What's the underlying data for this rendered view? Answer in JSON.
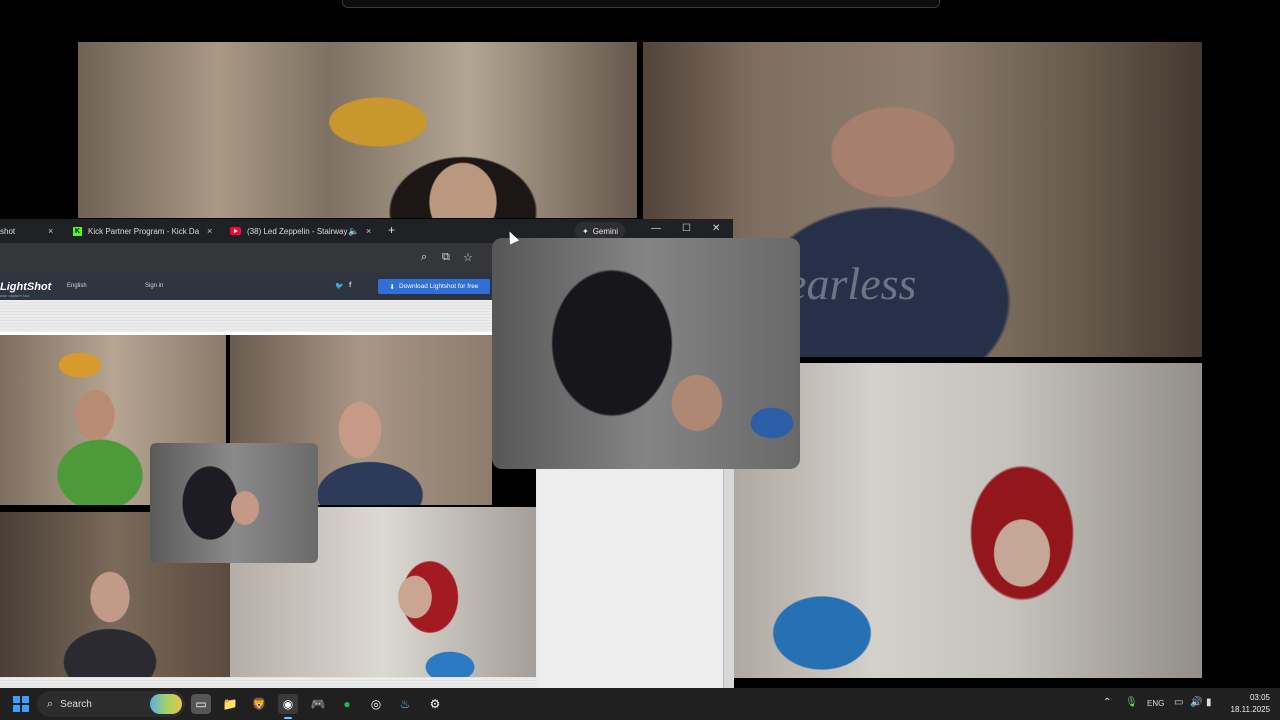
{
  "browser": {
    "tabs": [
      {
        "label": "shot",
        "close": "×"
      },
      {
        "label": "Kick Partner Program - Kick Da",
        "close": "×",
        "icon": "kick-icon"
      },
      {
        "label": "(38) Led Zeppelin - Stairway",
        "close": "×",
        "icon": "youtube-icon"
      }
    ],
    "new_tab": "+",
    "gemini_label": "Gemini",
    "window_controls": {
      "minimize": "—",
      "maximize": "☐",
      "close": "✕"
    }
  },
  "lightshot": {
    "logo": "LightShot",
    "tagline": "own capture tool",
    "language": "English",
    "sign_in": "Sign in",
    "download_label": "Download Lightshot for free"
  },
  "video": {
    "tshirt_text": "Fearless"
  },
  "taskbar": {
    "search_label": "Search",
    "language": "ENG",
    "time": "03:05",
    "date": "18.11.2025",
    "accent": "#60cdff"
  }
}
